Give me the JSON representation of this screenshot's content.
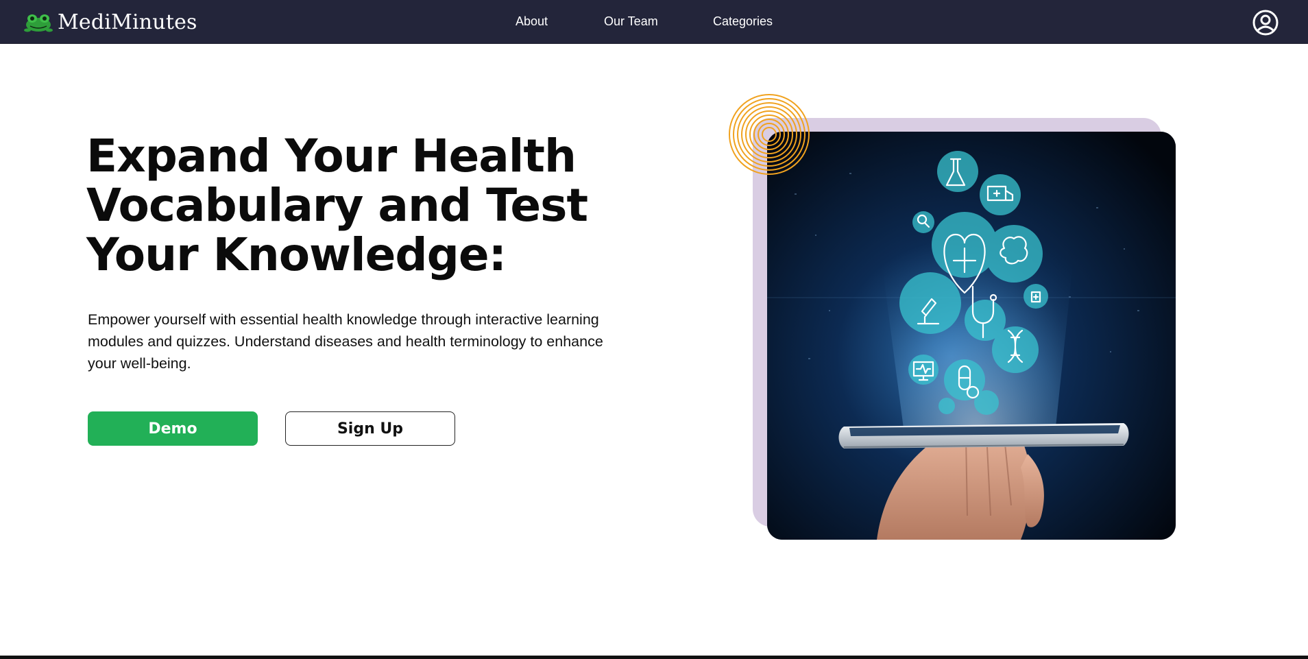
{
  "app": {
    "brand_name": "MediMinutes",
    "brand_icon": "frog-logo-icon"
  },
  "nav": {
    "items": [
      {
        "label": "About"
      },
      {
        "label": "Our Team"
      },
      {
        "label": "Categories"
      }
    ],
    "account_icon": "user-circle-icon"
  },
  "hero": {
    "title": "Expand Your Health Vocabulary and Test Your Knowledge:",
    "description": "Empower yourself with essential health knowledge through interactive learning modules and quizzes. Understand diseases and health terminology to enhance your well-being.",
    "demo_label": "Demo",
    "signup_label": "Sign Up"
  },
  "image": {
    "subject": "hand holding a tablet with floating medical icons",
    "icons": [
      "flask-icon",
      "ambulance-icon",
      "magnifier-icon",
      "heart-cross-icon",
      "brain-icon",
      "microscope-icon",
      "stethoscope-icon",
      "dna-icon",
      "monitor-pulse-icon",
      "pill-icon",
      "medical-kit-icon"
    ]
  },
  "colors": {
    "header_bg": "#23253a",
    "accent_green": "#22b057",
    "backplate_lavender": "#d9cde3",
    "swirl_orange": "#f0a21f"
  }
}
